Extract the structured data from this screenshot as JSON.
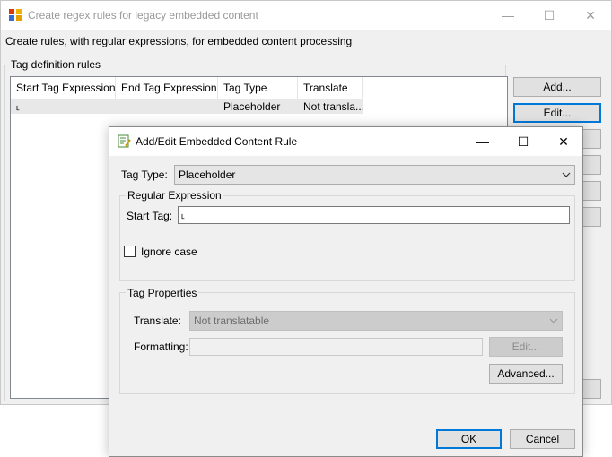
{
  "main_window": {
    "title": "Create regex rules for legacy embedded content",
    "minimize_glyph": "—",
    "maximize_glyph": "☐",
    "close_glyph": "✕",
    "description": "Create rules, with regular expressions, for  embedded content processing",
    "group_label": "Tag definition rules",
    "columns": [
      "Start Tag Expression",
      "End Tag Expression",
      "Tag Type",
      "Translate"
    ],
    "rows": [
      {
        "start": "˪",
        "end": "",
        "type": "Placeholder",
        "translate": "Not transla..."
      }
    ],
    "add_label": "Add...",
    "edit_label": "Edit..."
  },
  "dialog": {
    "title": "Add/Edit Embedded Content Rule",
    "minimize_glyph": "—",
    "maximize_glyph": "☐",
    "close_glyph": "✕",
    "tag_type_label": "Tag Type:",
    "tag_type_value": "Placeholder",
    "regex_group_label": "Regular Expression",
    "start_tag_label": "Start Tag:",
    "start_tag_value": "˪",
    "ignore_case_label": "Ignore case",
    "ignore_case_checked": false,
    "props_group_label": "Tag Properties",
    "translate_label": "Translate:",
    "translate_value": "Not translatable",
    "formatting_label": "Formatting:",
    "formatting_value": "",
    "format_edit_label": "Edit...",
    "advanced_label": "Advanced...",
    "ok_label": "OK",
    "cancel_label": "Cancel"
  },
  "icons": {
    "app": "app-grid-icon",
    "dialog": "edit-rule-icon",
    "dropdown": "chevron-down-icon"
  },
  "colors": {
    "accent": "#0078d7",
    "window_bg": "#f0f0f0",
    "disabled_bg": "#cccccc"
  }
}
